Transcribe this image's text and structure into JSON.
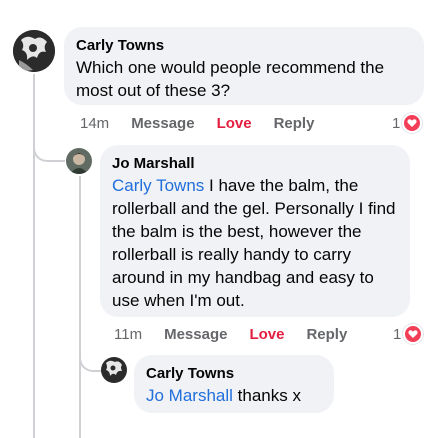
{
  "comments": [
    {
      "author": "Carly Towns",
      "line1": "Which one would people recommend the",
      "line2": "most out of these 3?",
      "time": "14m",
      "message_label": "Message",
      "love_label": "Love",
      "reply_label": "Reply",
      "reaction_count": "1"
    },
    {
      "author": "Jo Marshall",
      "mention": "Carly Towns",
      "line1_rest": " I have the balm, the",
      "line2": "rollerball and the gel. Personally I find",
      "line3": "the balm is the best, however the",
      "line4": "rollerball is really handy to carry",
      "line5": "around in my handbag and easy to",
      "line6": "use when I'm out.",
      "time": "11m",
      "message_label": "Message",
      "love_label": "Love",
      "reply_label": "Reply",
      "reaction_count": "1"
    },
    {
      "author": "Carly Towns",
      "mention": "Jo Marshall",
      "line1_rest": " thanks x"
    }
  ],
  "colors": {
    "bubble": "#f0f2f5",
    "mention": "#216fdb",
    "love": "#e41e3f",
    "meta": "#65676b",
    "thread_line": "#ced0d4"
  }
}
